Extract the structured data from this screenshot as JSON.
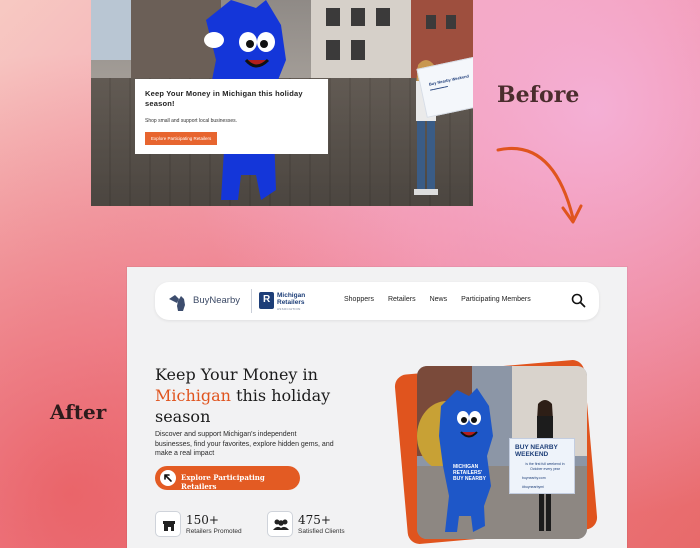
{
  "labels": {
    "before": "Before",
    "after": "After"
  },
  "before": {
    "card_title": "Keep Your Money in  Michigan this holiday season!",
    "card_text": "Shop small and support local businesses.",
    "card_button": "Explore Participating Retailers",
    "sign_title": "Buy Nearby Weekend"
  },
  "after": {
    "nav": {
      "logo_text": "BuyNearby",
      "partner_name": "Michigan Retailers",
      "partner_sub": "ASSOCIATION",
      "links": [
        "Shoppers",
        "Retailers",
        "News",
        "Participating Members"
      ]
    },
    "hero": {
      "title_line1": "Keep Your Money in",
      "title_accent": "Michigan",
      "title_rest": "this holiday season",
      "description": "Discover and support Michigan's independent businesses, find your favorites, explore hidden gems, and make a real impact",
      "cta_label": "Explore Participating Retailers"
    },
    "stats": [
      {
        "number": "150+",
        "caption": "Retailers Promoted",
        "icon": "store-icon"
      },
      {
        "number": "475+",
        "caption": "Satisfied Clients",
        "icon": "people-icon"
      }
    ],
    "photo_sign": {
      "title": "BUY NEARBY WEEKEND",
      "sub": "is the first full weekend in October every year",
      "line3": "buynearby.com",
      "line4": "#buynearbymi"
    }
  },
  "colors": {
    "accent": "#e0541e",
    "navy": "#1d3e78",
    "mascot_blue": "#1436d9"
  }
}
